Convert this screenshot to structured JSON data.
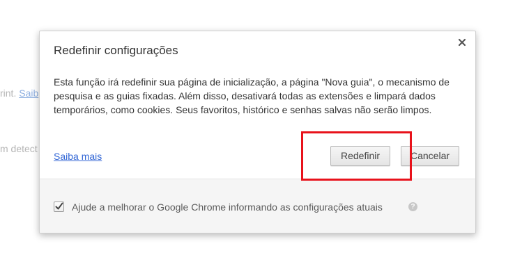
{
  "background": {
    "line1_text": "rint. ",
    "line1_link": "Saib",
    "line2_text": "m detect"
  },
  "dialog": {
    "title": "Redefinir configurações",
    "body": "Esta função irá redefinir sua página de inicialização, a página \"Nova guia\", o mecanismo de pesquisa e as guias fixadas. Além disso, desativará todas as extensões e limpará dados temporários, como cookies. Seus favoritos, histórico e senhas salvas não serão limpos.",
    "learn_more_label": "Saiba mais",
    "reset_button_label": "Redefinir",
    "cancel_button_label": "Cancelar",
    "close_icon": "close-icon",
    "footer": {
      "checkbox_checked": true,
      "checkbox_label": "Ajude a melhorar o Google Chrome informando as configurações atuais",
      "help_icon_glyph": "?"
    }
  },
  "colors": {
    "link": "#3367d6",
    "highlight": "#e8121b",
    "footer_bg": "#f5f5f5"
  }
}
